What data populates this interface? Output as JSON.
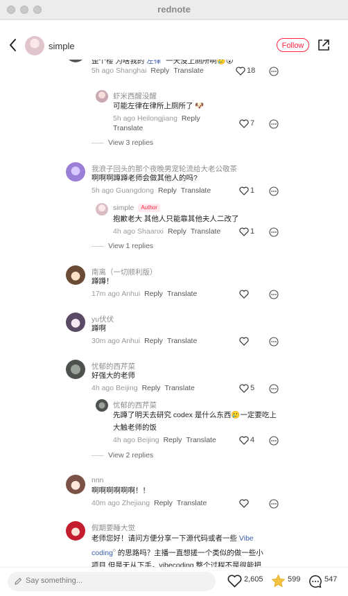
{
  "window": {
    "title": "rednote"
  },
  "header": {
    "username": "simple",
    "follow_label": "Follow"
  },
  "composer": {
    "placeholder": "Say something..."
  },
  "stats": {
    "likes": "2,605",
    "collects": "599",
    "comments": "547"
  },
  "actions": {
    "reply": "Reply",
    "translate": "Translate"
  },
  "author_badge": "Author",
  "comments": [
    {
      "text_a": "歪个楼 为啥我的 ",
      "link": "左律",
      "text_b": " 一天没上厕所啊",
      "time": "5h ago",
      "location": "Shanghai",
      "likes": "18"
    },
    {
      "user": "虾米西醒没醒",
      "text": "可能左律在律所上厕所了",
      "time": "5h ago",
      "location": "Heilongjiang",
      "likes": "7",
      "view_replies": "View 3 replies"
    },
    {
      "user": "我浪子回头的那个夜晚男宠轮流给大老公敬茶",
      "text": "啊啊啊蹲蹲老师会做其他人的吗?",
      "time": "5h ago",
      "location": "Guangdong",
      "likes": "1"
    },
    {
      "user": "simple",
      "text": "抱歉老大 其他人只能靠其他夫人二改了",
      "time": "4h ago",
      "location": "Shaanxi",
      "likes": "1",
      "view_replies": "View 1 replies"
    },
    {
      "user": "南离（一切顺利版）",
      "text": "蹲蹲！",
      "time": "17m ago",
      "location": "Anhui"
    },
    {
      "user": "yu伏伏",
      "text": "蹲啊",
      "time": "30m ago",
      "location": "Anhui"
    },
    {
      "user": "忧郁的西芹菜",
      "text": "好强大的老师",
      "time": "4h ago",
      "location": "Beijing",
      "likes": "5"
    },
    {
      "user": "忧郁的西芹菜",
      "text_a": "先蹲了明天去研究 codex 是什么东西",
      "text_b": "一定要吃上大触老师的饭",
      "time": "4h ago",
      "location": "Beijing",
      "likes": "4",
      "view_replies": "View 2 replies"
    },
    {
      "user": "nnn",
      "text": "啊啊啊啊啊啊！！",
      "time": "40m ago",
      "location": "Zhejiang"
    },
    {
      "user": "假期要睡大觉",
      "text_a": "老师您好！请问方便分享一下源代码或者一些 ",
      "link": "Vibe coding",
      "text_b": " 的思路吗？主播一直想搓一个类似的做一些小项目 但是无从下手，vibecoding 整个过程不是很能把握"
    }
  ]
}
